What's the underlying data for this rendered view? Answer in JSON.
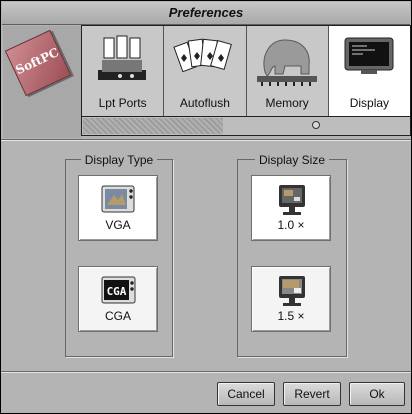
{
  "window": {
    "title": "Preferences"
  },
  "logo": {
    "text": "SoftPC"
  },
  "tabs": [
    {
      "label": "Lpt Ports",
      "icon": "printer-icon"
    },
    {
      "label": "Autoflush",
      "icon": "cards-icon"
    },
    {
      "label": "Memory",
      "icon": "elephant-icon"
    },
    {
      "label": "Display",
      "icon": "monitor-icon",
      "selected": true
    }
  ],
  "display_type": {
    "title": "Display Type",
    "options": [
      {
        "label": "VGA",
        "icon": "vga-icon",
        "selected": true
      },
      {
        "label": "CGA",
        "icon": "cga-icon",
        "icon_text": "CGA",
        "selected": false
      }
    ]
  },
  "display_size": {
    "title": "Display Size",
    "options": [
      {
        "label": "1.0 ×",
        "icon": "monitor-small-icon",
        "selected": true
      },
      {
        "label": "1.5 ×",
        "icon": "monitor-large-icon",
        "selected": false
      }
    ]
  },
  "buttons": {
    "cancel": "Cancel",
    "revert": "Revert",
    "ok": "Ok"
  }
}
